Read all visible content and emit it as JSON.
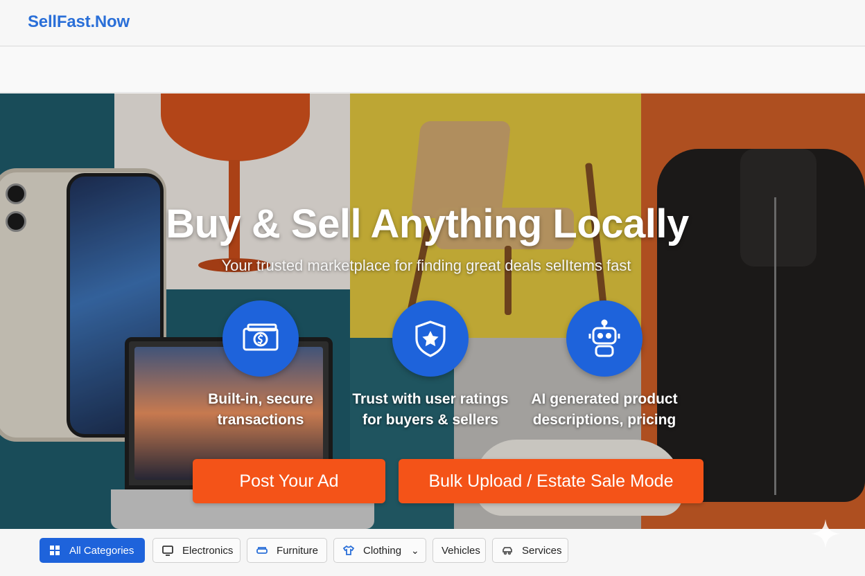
{
  "header": {
    "brand": "SellFast.Now"
  },
  "hero": {
    "title": "Buy & Sell Anything Locally",
    "subtitle": "Your trusted marketplace for finding great deals selItems fast",
    "features": [
      {
        "icon": "money-icon",
        "text": "Built-in, secure\ntransactions"
      },
      {
        "icon": "shield-star-icon",
        "text": "Trust with user ratings\nfor buyers & sellers"
      },
      {
        "icon": "robot-icon",
        "text": "AI generated product\ndescriptions, pricing"
      }
    ],
    "cta_post": "Post Your Ad",
    "cta_bulk": "Bulk Upload / Estate Sale Mode"
  },
  "categories": [
    {
      "label": "All Categories",
      "icon": "grid-icon",
      "active": true
    },
    {
      "label": "Electronics",
      "icon": "monitor-icon"
    },
    {
      "label": "Furniture",
      "icon": "sofa-icon"
    },
    {
      "label": "Clothing",
      "icon": "shirt-icon",
      "dropdown": true
    },
    {
      "label": "Vehicles"
    },
    {
      "label": "Services",
      "icon": "car-icon"
    }
  ],
  "colors": {
    "brand": "#2a6fd8",
    "accent": "#f45318",
    "primary": "#1e63db"
  }
}
